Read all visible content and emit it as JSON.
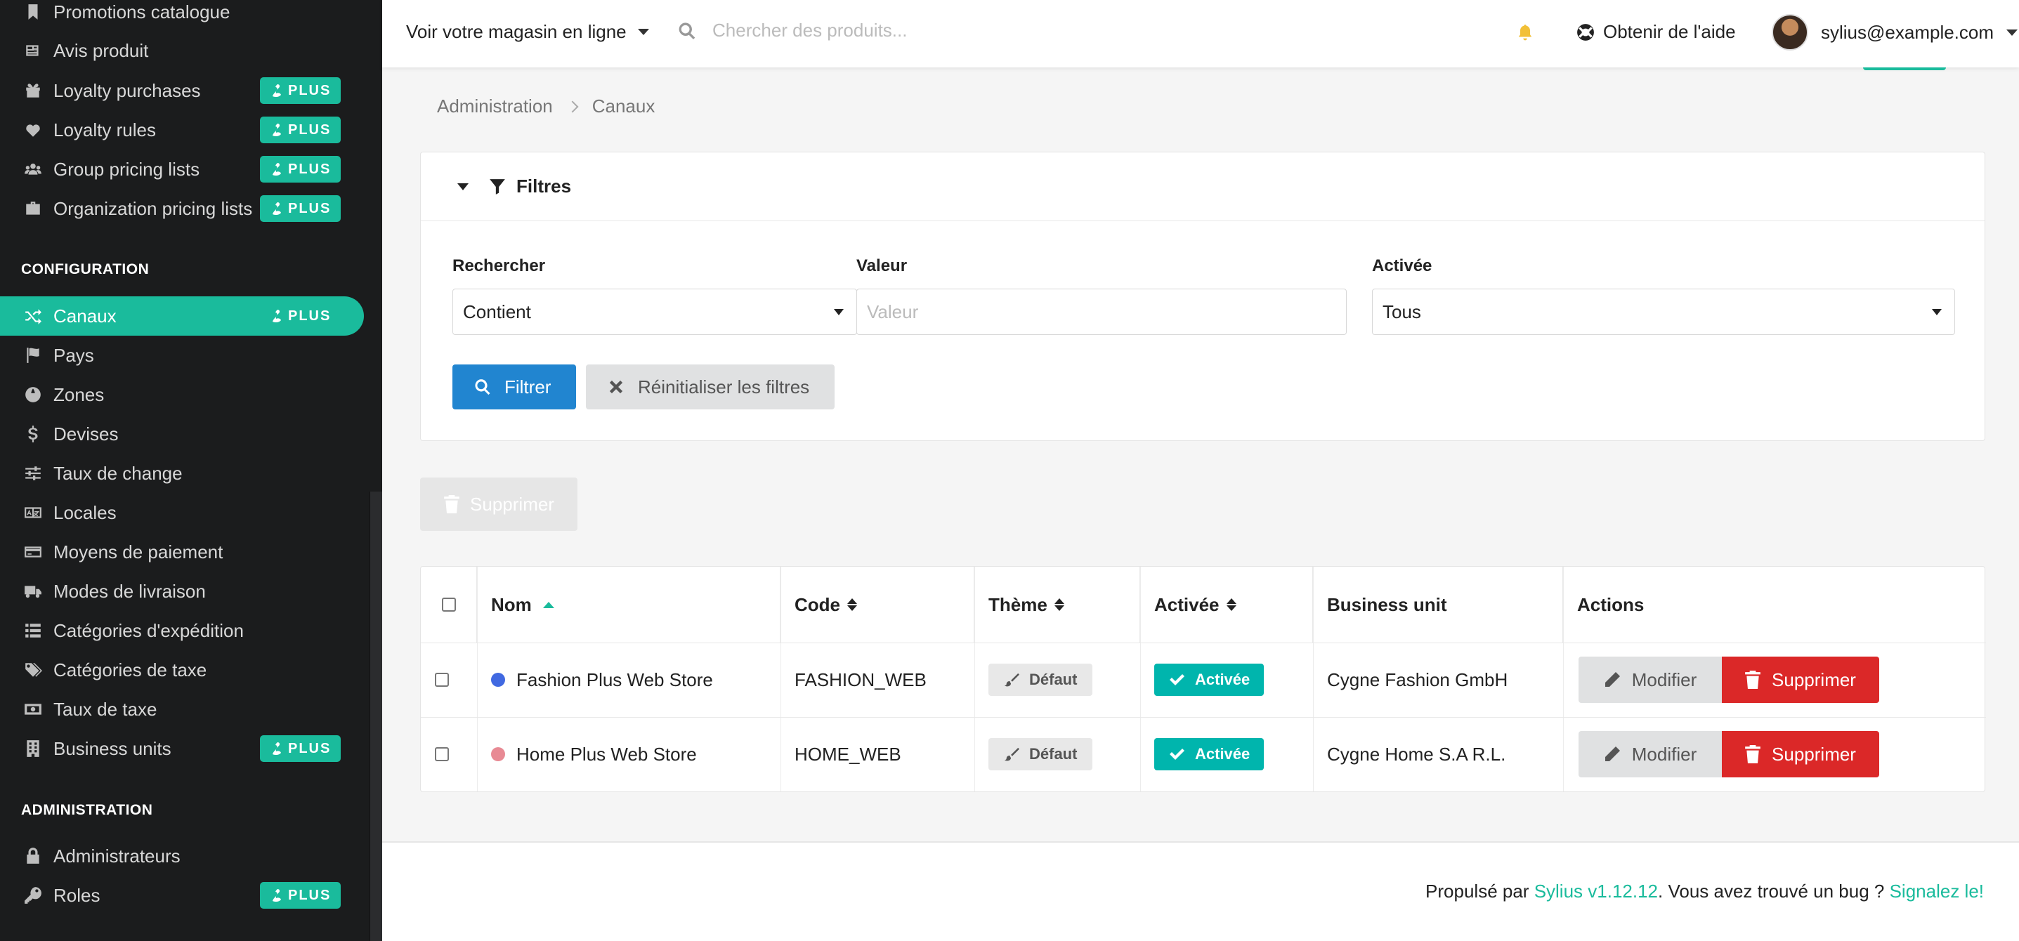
{
  "sidebar": {
    "top_items": [
      {
        "label": "Promotions catalogue",
        "icon": "bookmark-icon",
        "plus": false
      },
      {
        "label": "Avis produit",
        "icon": "newspaper-icon",
        "plus": false
      },
      {
        "label": "Loyalty purchases",
        "icon": "gift-icon",
        "plus": true
      },
      {
        "label": "Loyalty rules",
        "icon": "heart-icon",
        "plus": true
      },
      {
        "label": "Group pricing lists",
        "icon": "users-icon",
        "plus": true
      },
      {
        "label": "Organization pricing lists",
        "icon": "briefcase-icon",
        "plus": true
      }
    ],
    "config_header": "CONFIGURATION",
    "config_items": [
      {
        "label": "Canaux",
        "icon": "random-icon",
        "plus": true,
        "active": true
      },
      {
        "label": "Pays",
        "icon": "flag-icon",
        "plus": false
      },
      {
        "label": "Zones",
        "icon": "globe-icon",
        "plus": false
      },
      {
        "label": "Devises",
        "icon": "dollar-icon",
        "plus": false
      },
      {
        "label": "Taux de change",
        "icon": "sliders-icon",
        "plus": false
      },
      {
        "label": "Locales",
        "icon": "language-icon",
        "plus": false
      },
      {
        "label": "Moyens de paiement",
        "icon": "credit-card-icon",
        "plus": false
      },
      {
        "label": "Modes de livraison",
        "icon": "truck-icon",
        "plus": false
      },
      {
        "label": "Catégories d'expédition",
        "icon": "list-icon",
        "plus": false
      },
      {
        "label": "Catégories de taxe",
        "icon": "tags-icon",
        "plus": false
      },
      {
        "label": "Taux de taxe",
        "icon": "money-icon",
        "plus": false
      },
      {
        "label": "Business units",
        "icon": "building-icon",
        "plus": true
      }
    ],
    "admin_header": "ADMINISTRATION",
    "admin_items": [
      {
        "label": "Administrateurs",
        "icon": "lock-icon",
        "plus": false
      },
      {
        "label": "Roles",
        "icon": "key-icon",
        "plus": true
      }
    ],
    "plus_label": "PLUS"
  },
  "topbar": {
    "store_label": "Voir votre magasin en ligne",
    "search_placeholder": "Chercher des produits...",
    "help_label": "Obtenir de l'aide",
    "user_email": "sylius@example.com"
  },
  "breadcrumb": {
    "root": "Administration",
    "current": "Canaux"
  },
  "filters": {
    "title": "Filtres",
    "search_label": "Rechercher",
    "search_type": "Contient",
    "value_label": "Valeur",
    "value_placeholder": "Valeur",
    "enabled_label": "Activée",
    "enabled_value": "Tous",
    "filter_button": "Filtrer",
    "reset_button": "Réinitialiser les filtres"
  },
  "bulk_delete": "Supprimer",
  "table": {
    "headers": {
      "name": "Nom",
      "code": "Code",
      "theme": "Thème",
      "enabled": "Activée",
      "business_unit": "Business unit",
      "actions": "Actions"
    },
    "rows": [
      {
        "name": "Fashion Plus Web Store",
        "color": "#4169e1",
        "code": "FASHION_WEB",
        "theme": "Défaut",
        "enabled": "Activée",
        "business_unit": "Cygne Fashion GmbH"
      },
      {
        "name": "Home Plus Web Store",
        "color": "#e88a94",
        "code": "HOME_WEB",
        "theme": "Défaut",
        "enabled": "Activée",
        "business_unit": "Cygne Home S.A R.L."
      }
    ],
    "edit_label": "Modifier",
    "delete_label": "Supprimer"
  },
  "footer": {
    "prefix": "Propulsé par ",
    "link": "Sylius v1.12.12",
    "middle": ". Vous avez trouvé un bug ? ",
    "report": "Signalez le!"
  },
  "colors": {
    "accent": "#1abb9c",
    "primary": "#2185d0",
    "danger": "#db2828",
    "teal": "#00b5ad"
  }
}
